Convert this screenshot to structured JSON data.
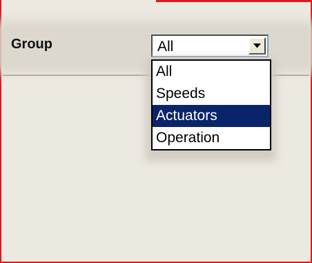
{
  "window": {
    "accent_color": "#e0181e"
  },
  "group": {
    "label": "Group",
    "select": {
      "value": "All",
      "options": [
        "All",
        "Speeds",
        "Actuators",
        "Operation"
      ],
      "highlighted_option": "Actuators",
      "highlight_color": "#0a246a",
      "arrow_icon": "chevron-down-icon"
    }
  }
}
